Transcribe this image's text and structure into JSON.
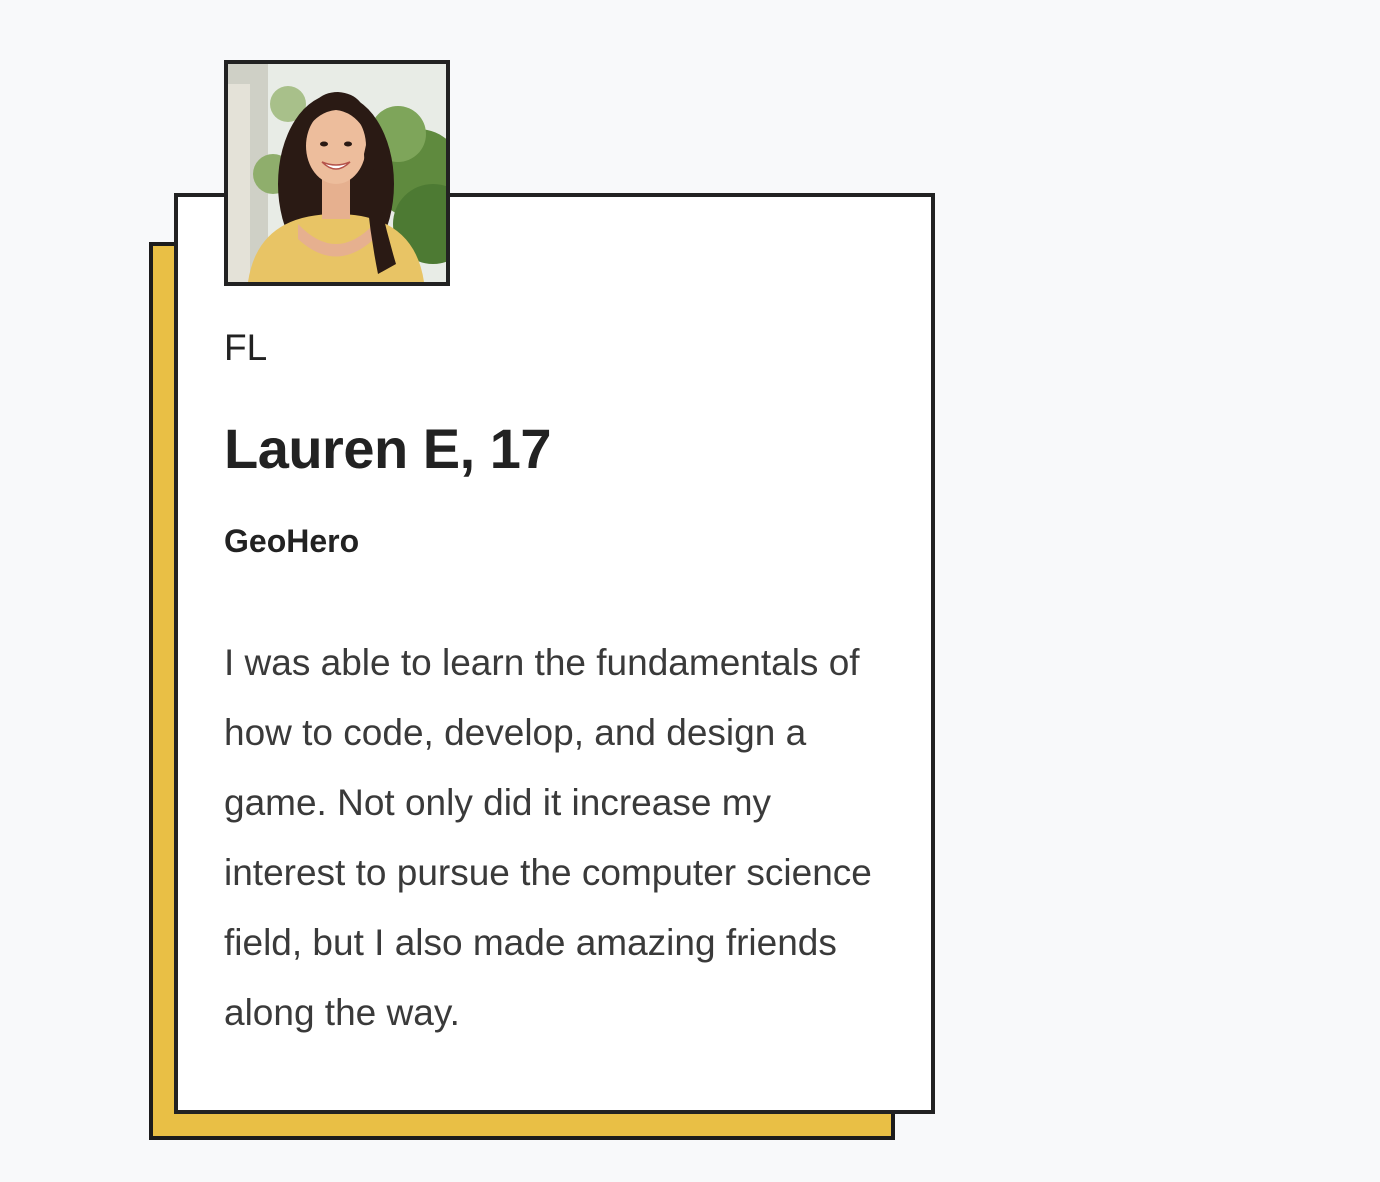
{
  "testimonial": {
    "photo_icon": "student-portrait-photo",
    "state": "FL",
    "name": "Lauren E, 17",
    "project": "GeoHero",
    "quote": "I was able to learn the fundamentals of how to code, develop, and design a game. Not only did it increase my interest to pursue the computer science field, but I also made amazing friends along the way."
  },
  "colors": {
    "accent": "#e9bf45",
    "border": "#222222",
    "background": "#f8f9fa",
    "card": "#ffffff"
  }
}
